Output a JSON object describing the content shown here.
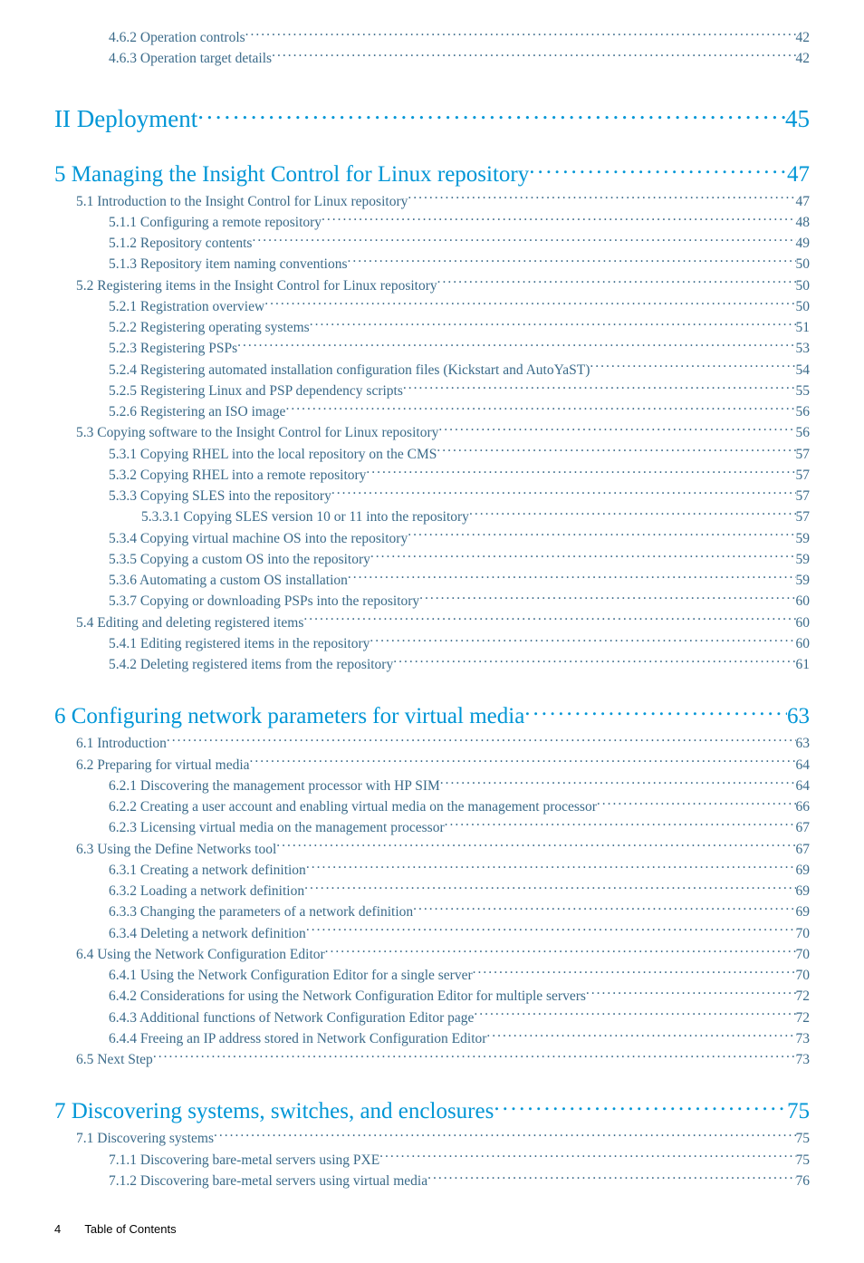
{
  "pre": [
    {
      "indent": 2,
      "label": "4.6.2 Operation controls",
      "page": "42"
    },
    {
      "indent": 2,
      "label": "4.6.3 Operation target details",
      "page": "42"
    }
  ],
  "part2": {
    "label": "II Deployment",
    "page": "45"
  },
  "ch5": {
    "title": {
      "label": "5 Managing the Insight Control for Linux repository",
      "page": "47"
    },
    "items": [
      {
        "indent": 1,
        "label": "5.1 Introduction to the Insight Control for Linux repository ",
        "page": "47"
      },
      {
        "indent": 2,
        "label": "5.1.1 Configuring a remote repository",
        "page": "48"
      },
      {
        "indent": 2,
        "label": "5.1.2 Repository contents",
        "page": "49"
      },
      {
        "indent": 2,
        "label": "5.1.3 Repository item naming conventions",
        "page": "50"
      },
      {
        "indent": 1,
        "label": "5.2 Registering items in the Insight Control for Linux repository",
        "page": "50"
      },
      {
        "indent": 2,
        "label": "5.2.1 Registration overview",
        "page": "50"
      },
      {
        "indent": 2,
        "label": "5.2.2 Registering operating systems",
        "page": "51"
      },
      {
        "indent": 2,
        "label": "5.2.3 Registering PSPs",
        "page": "53"
      },
      {
        "indent": 2,
        "label": "5.2.4 Registering automated installation configuration files (Kickstart and AutoYaST)",
        "page": "54"
      },
      {
        "indent": 2,
        "label": "5.2.5 Registering Linux and PSP dependency scripts",
        "page": "55"
      },
      {
        "indent": 2,
        "label": "5.2.6 Registering an ISO image",
        "page": "56"
      },
      {
        "indent": 1,
        "label": "5.3 Copying software to the Insight Control for Linux repository",
        "page": "56"
      },
      {
        "indent": 2,
        "label": "5.3.1 Copying RHEL into the local repository on the CMS",
        "page": "57"
      },
      {
        "indent": 2,
        "label": "5.3.2 Copying RHEL into a remote repository",
        "page": "57"
      },
      {
        "indent": 2,
        "label": "5.3.3 Copying SLES into the repository",
        "page": "57"
      },
      {
        "indent": 3,
        "label": "5.3.3.1 Copying SLES version 10 or 11 into the repository",
        "page": "57"
      },
      {
        "indent": 2,
        "label": "5.3.4 Copying virtual machine OS into the repository",
        "page": "59"
      },
      {
        "indent": 2,
        "label": "5.3.5 Copying a custom OS into the repository",
        "page": "59"
      },
      {
        "indent": 2,
        "label": "5.3.6 Automating a custom OS installation",
        "page": "59"
      },
      {
        "indent": 2,
        "label": "5.3.7 Copying or downloading PSPs into the repository",
        "page": "60"
      },
      {
        "indent": 1,
        "label": "5.4 Editing and deleting registered items",
        "page": "60"
      },
      {
        "indent": 2,
        "label": "5.4.1 Editing registered items in the repository",
        "page": "60"
      },
      {
        "indent": 2,
        "label": "5.4.2 Deleting registered items from the repository",
        "page": "61"
      }
    ]
  },
  "ch6": {
    "title": {
      "label": "6 Configuring network parameters for virtual media",
      "page": "63"
    },
    "items": [
      {
        "indent": 1,
        "label": "6.1  Introduction",
        "page": "63"
      },
      {
        "indent": 1,
        "label": "6.2 Preparing for virtual media",
        "page": "64"
      },
      {
        "indent": 2,
        "label": "6.2.1 Discovering the management processor with HP SIM",
        "page": "64"
      },
      {
        "indent": 2,
        "label": "6.2.2 Creating a user account and enabling virtual media on the management processor",
        "page": "66"
      },
      {
        "indent": 2,
        "label": "6.2.3 Licensing virtual media on the management processor",
        "page": "67"
      },
      {
        "indent": 1,
        "label": "6.3 Using the Define Networks tool",
        "page": "67"
      },
      {
        "indent": 2,
        "label": "6.3.1 Creating a network definition",
        "page": "69"
      },
      {
        "indent": 2,
        "label": "6.3.2 Loading a network definition",
        "page": "69"
      },
      {
        "indent": 2,
        "label": "6.3.3 Changing the parameters of a network definition",
        "page": "69"
      },
      {
        "indent": 2,
        "label": "6.3.4 Deleting a network definition",
        "page": "70"
      },
      {
        "indent": 1,
        "label": "6.4 Using the Network Configuration Editor",
        "page": "70"
      },
      {
        "indent": 2,
        "label": "6.4.1 Using the Network Configuration Editor for a single server",
        "page": "70"
      },
      {
        "indent": 2,
        "label": "6.4.2 Considerations for using the Network Configuration Editor for multiple servers",
        "page": "72"
      },
      {
        "indent": 2,
        "label": "6.4.3 Additional functions of Network Configuration Editor page",
        "page": "72"
      },
      {
        "indent": 2,
        "label": "6.4.4 Freeing an IP address stored in Network Configuration Editor",
        "page": "73"
      },
      {
        "indent": 1,
        "label": "6.5 Next Step",
        "page": "73"
      }
    ]
  },
  "ch7": {
    "title": {
      "label": "7 Discovering systems, switches, and enclosures",
      "page": "75"
    },
    "items": [
      {
        "indent": 1,
        "label": "7.1 Discovering systems",
        "page": "75"
      },
      {
        "indent": 2,
        "label": "7.1.1 Discovering bare-metal servers using PXE",
        "page": "75"
      },
      {
        "indent": 2,
        "label": "7.1.2 Discovering bare-metal servers using virtual media",
        "page": "76"
      }
    ]
  },
  "footer": {
    "page": "4",
    "title": "Table of Contents"
  }
}
